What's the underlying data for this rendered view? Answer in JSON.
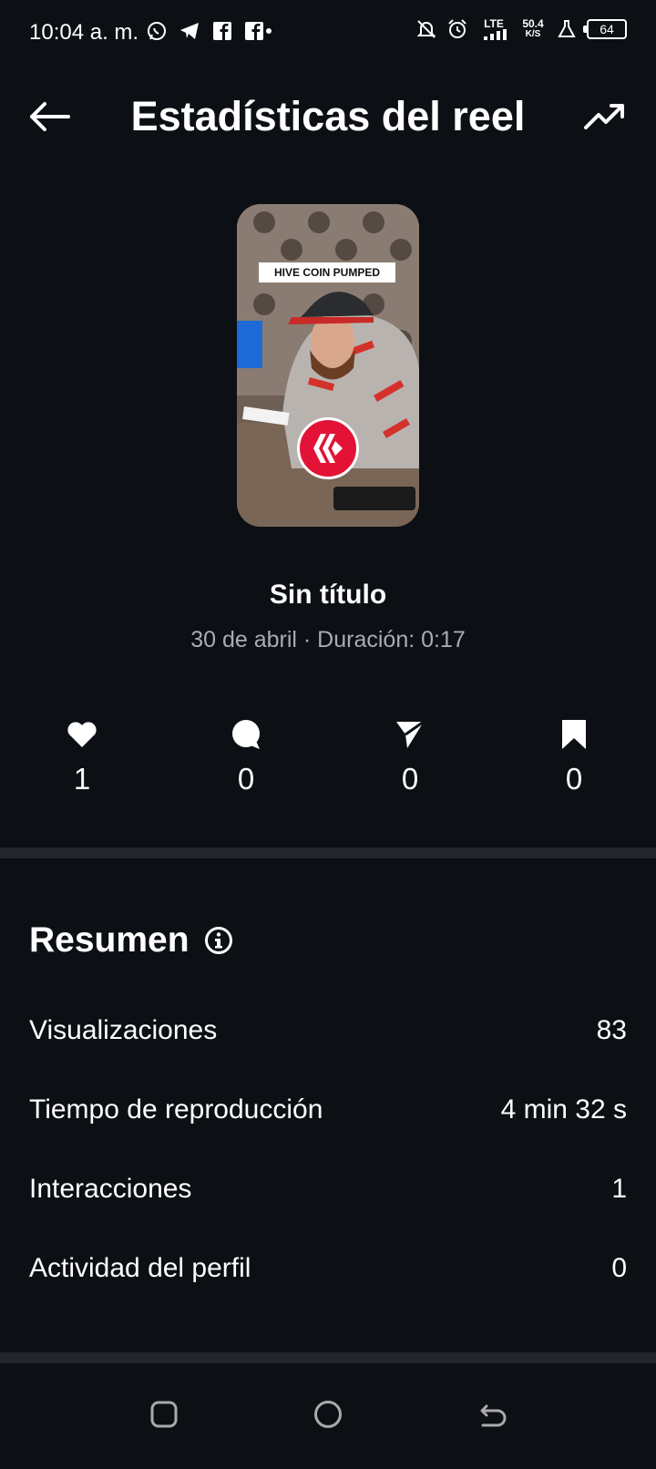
{
  "status_bar": {
    "time": "10:04 a. m.",
    "network_type": "LTE",
    "speed": "50.4",
    "speed_unit": "K/S",
    "battery": "64",
    "left_icons": [
      "whatsapp-icon",
      "telegram-icon",
      "facebook-icon",
      "facebook-icon"
    ],
    "right_icons": [
      "bell-off-icon",
      "alarm-icon",
      "signal-icon",
      "lab-icon",
      "battery-icon"
    ]
  },
  "header": {
    "title": "Estadísticas del reel",
    "back_icon": "arrow-left-icon",
    "trend_icon": "trending-up-icon"
  },
  "reel": {
    "caption_overlay": "HIVE COIN PUMPED",
    "title": "Sin título",
    "meta": "30 de abril · Duración: 0:17"
  },
  "engagement": [
    {
      "icon": "heart-icon",
      "count": "1"
    },
    {
      "icon": "comment-icon",
      "count": "0"
    },
    {
      "icon": "share-icon",
      "count": "0"
    },
    {
      "icon": "bookmark-icon",
      "count": "0"
    }
  ],
  "summary": {
    "heading": "Resumen",
    "rows": [
      {
        "label": "Visualizaciones",
        "value": "83"
      },
      {
        "label": "Tiempo de reproducción",
        "value": "4 min 32 s"
      },
      {
        "label": "Interacciones",
        "value": "1"
      },
      {
        "label": "Actividad del perfil",
        "value": "0"
      }
    ]
  },
  "colors": {
    "background": "#0c0f14",
    "divider": "#22252b",
    "secondary_text": "#a8acb3",
    "hive_red": "#e31337"
  }
}
